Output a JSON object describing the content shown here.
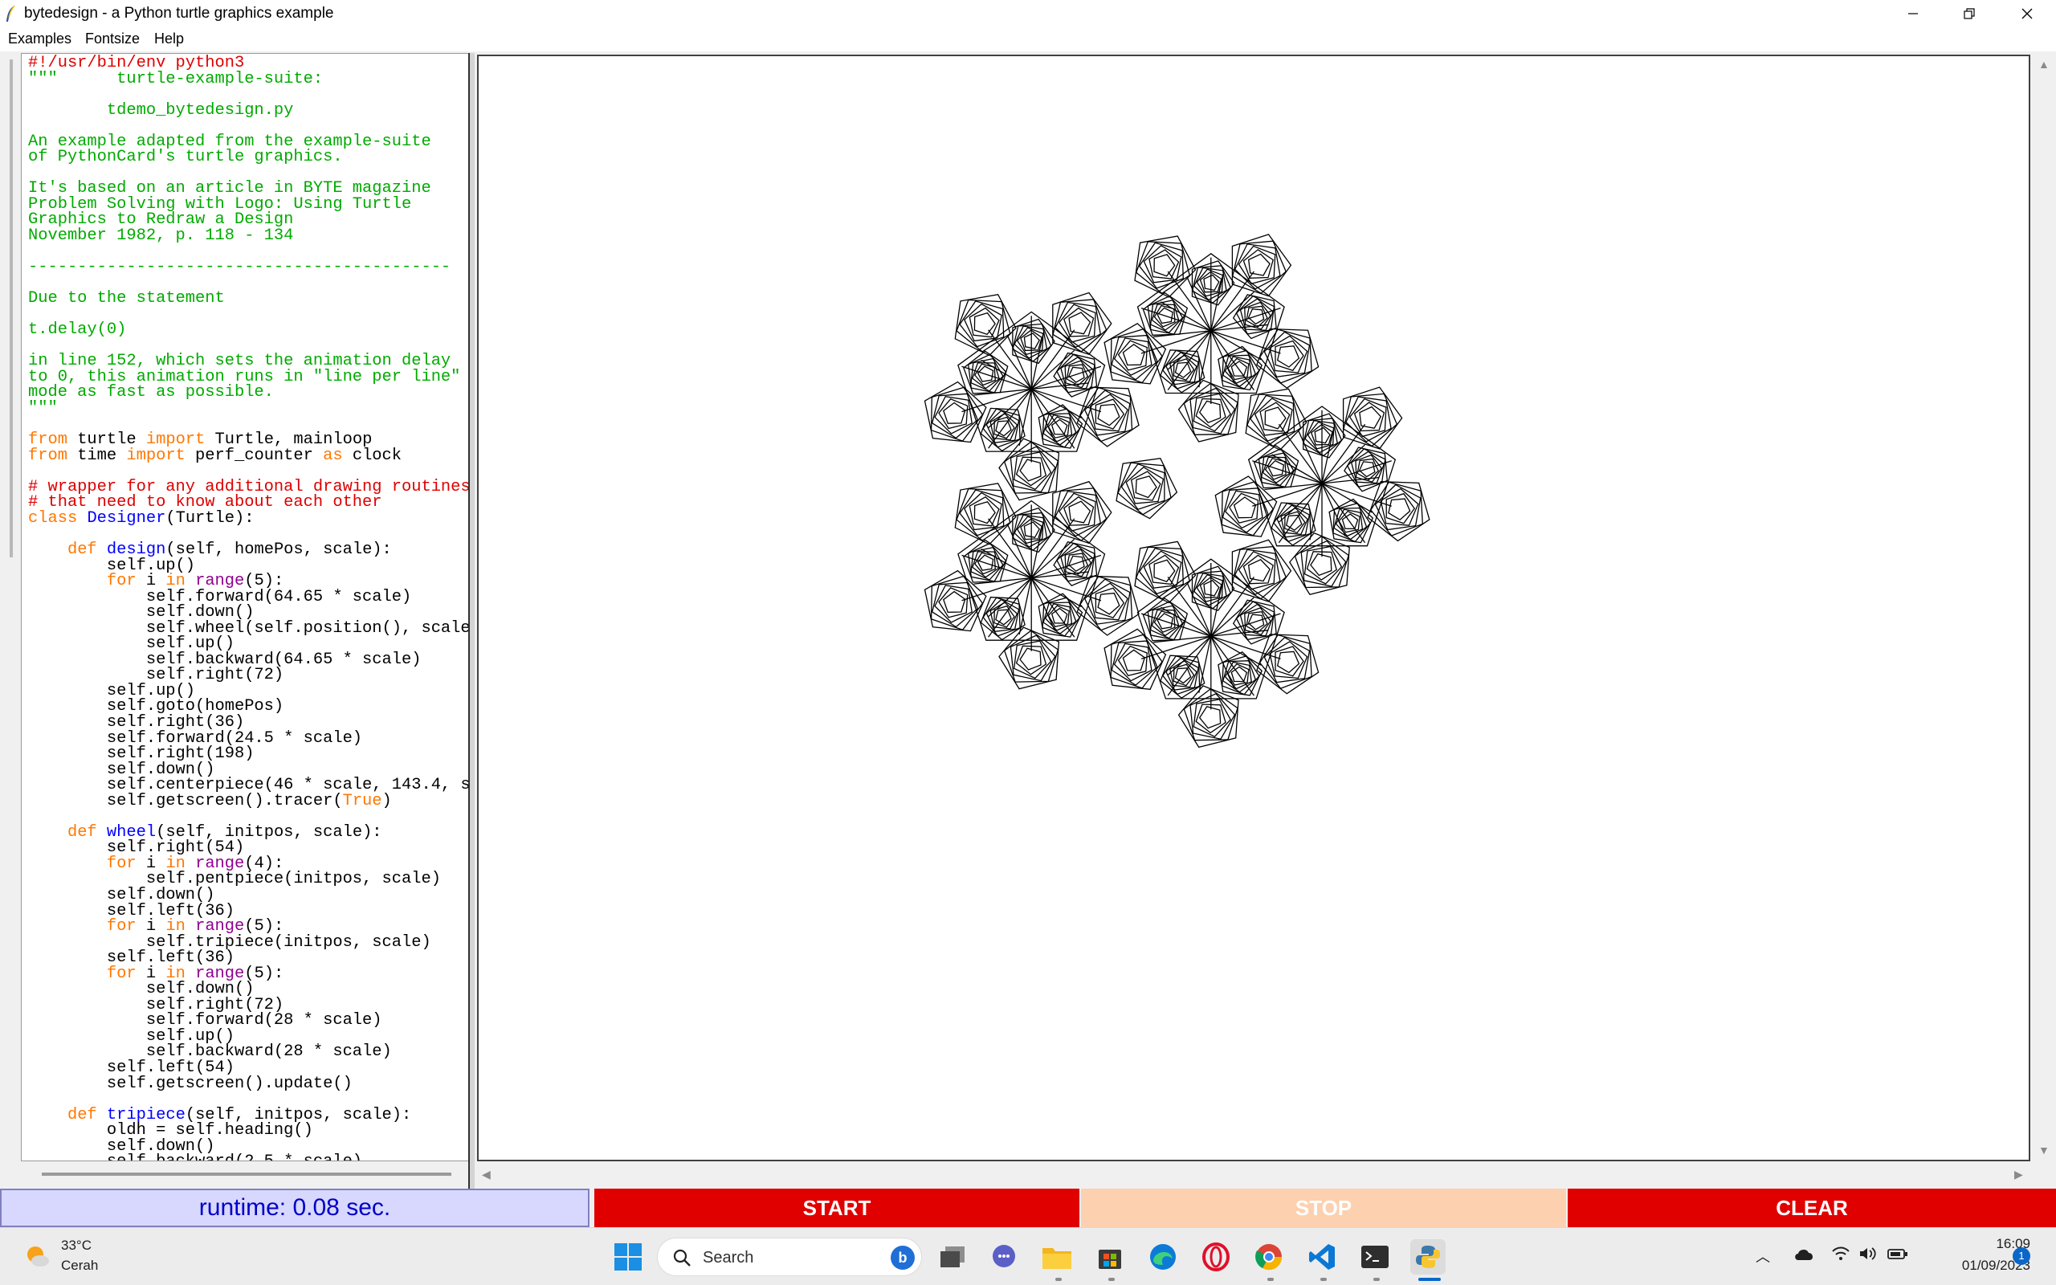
{
  "window": {
    "title": "bytedesign - a Python turtle graphics example"
  },
  "menu": [
    "Examples",
    "Fontsize",
    "Help"
  ],
  "code_lines": [
    [
      [
        "c-cmt",
        "#!/usr/bin/env python3"
      ]
    ],
    [
      [
        "c-str",
        "\"\"\"      turtle-example-suite:"
      ]
    ],
    [
      [
        "",
        ""
      ]
    ],
    [
      [
        "c-str",
        "        tdemo_bytedesign.py"
      ]
    ],
    [
      [
        "",
        ""
      ]
    ],
    [
      [
        "c-str",
        "An example adapted from the example-suite"
      ]
    ],
    [
      [
        "c-str",
        "of PythonCard's turtle graphics."
      ]
    ],
    [
      [
        "",
        ""
      ]
    ],
    [
      [
        "c-str",
        "It's based on an article in BYTE magazine"
      ]
    ],
    [
      [
        "c-str",
        "Problem Solving with Logo: Using Turtle"
      ]
    ],
    [
      [
        "c-str",
        "Graphics to Redraw a Design"
      ]
    ],
    [
      [
        "c-str",
        "November 1982, p. 118 - 134"
      ]
    ],
    [
      [
        "",
        ""
      ]
    ],
    [
      [
        "c-str",
        "-------------------------------------------"
      ]
    ],
    [
      [
        "",
        ""
      ]
    ],
    [
      [
        "c-str",
        "Due to the statement"
      ]
    ],
    [
      [
        "",
        ""
      ]
    ],
    [
      [
        "c-str",
        "t.delay(0)"
      ]
    ],
    [
      [
        "",
        ""
      ]
    ],
    [
      [
        "c-str",
        "in line 152, which sets the animation delay"
      ]
    ],
    [
      [
        "c-str",
        "to 0, this animation runs in \"line per line\""
      ]
    ],
    [
      [
        "c-str",
        "mode as fast as possible."
      ]
    ],
    [
      [
        "c-str",
        "\"\"\""
      ]
    ],
    [
      [
        "",
        ""
      ]
    ],
    [
      [
        "c-kw",
        "from"
      ],
      [
        "",
        " turtle "
      ],
      [
        "c-kw",
        "import"
      ],
      [
        "",
        " Turtle, mainloop"
      ]
    ],
    [
      [
        "c-kw",
        "from"
      ],
      [
        "",
        " time "
      ],
      [
        "c-kw",
        "import"
      ],
      [
        "",
        " perf_counter "
      ],
      [
        "c-kw",
        "as"
      ],
      [
        "",
        " clock"
      ]
    ],
    [
      [
        "",
        ""
      ]
    ],
    [
      [
        "c-cmt",
        "# wrapper for any additional drawing routines"
      ]
    ],
    [
      [
        "c-cmt",
        "# that need to know about each other"
      ]
    ],
    [
      [
        "c-kw",
        "class"
      ],
      [
        "",
        " "
      ],
      [
        "c-def",
        "Designer"
      ],
      [
        "",
        "(Turtle):"
      ]
    ],
    [
      [
        "",
        ""
      ]
    ],
    [
      [
        "",
        "    "
      ],
      [
        "c-kw",
        "def"
      ],
      [
        "",
        " "
      ],
      [
        "c-def",
        "design"
      ],
      [
        "",
        "(self, homePos, scale):"
      ]
    ],
    [
      [
        "",
        "        self.up()"
      ]
    ],
    [
      [
        "",
        "        "
      ],
      [
        "c-kw",
        "for"
      ],
      [
        "",
        " i "
      ],
      [
        "c-kw",
        "in"
      ],
      [
        "",
        " "
      ],
      [
        "c-blt",
        "range"
      ],
      [
        "",
        "(5):"
      ]
    ],
    [
      [
        "",
        "            self.forward(64.65 * scale)"
      ]
    ],
    [
      [
        "",
        "            self.down()"
      ]
    ],
    [
      [
        "",
        "            self.wheel(self.position(), scale"
      ]
    ],
    [
      [
        "",
        "            self.up()"
      ]
    ],
    [
      [
        "",
        "            self.backward(64.65 * scale)"
      ]
    ],
    [
      [
        "",
        "            self.right(72)"
      ]
    ],
    [
      [
        "",
        "        self.up()"
      ]
    ],
    [
      [
        "",
        "        self.goto(homePos)"
      ]
    ],
    [
      [
        "",
        "        self.right(36)"
      ]
    ],
    [
      [
        "",
        "        self.forward(24.5 * scale)"
      ]
    ],
    [
      [
        "",
        "        self.right(198)"
      ]
    ],
    [
      [
        "",
        "        self.down()"
      ]
    ],
    [
      [
        "",
        "        self.centerpiece(46 * scale, 143.4, s"
      ]
    ],
    [
      [
        "",
        "        self.getscreen().tracer("
      ],
      [
        "c-tf",
        "True"
      ],
      [
        "",
        ")"
      ]
    ],
    [
      [
        "",
        ""
      ]
    ],
    [
      [
        "",
        "    "
      ],
      [
        "c-kw",
        "def"
      ],
      [
        "",
        " "
      ],
      [
        "c-def",
        "wheel"
      ],
      [
        "",
        "(self, initpos, scale):"
      ]
    ],
    [
      [
        "",
        "        self.right(54)"
      ]
    ],
    [
      [
        "",
        "        "
      ],
      [
        "c-kw",
        "for"
      ],
      [
        "",
        " i "
      ],
      [
        "c-kw",
        "in"
      ],
      [
        "",
        " "
      ],
      [
        "c-blt",
        "range"
      ],
      [
        "",
        "(4):"
      ]
    ],
    [
      [
        "",
        "            self.pentpiece(initpos, scale)"
      ]
    ],
    [
      [
        "",
        "        self.down()"
      ]
    ],
    [
      [
        "",
        "        self.left(36)"
      ]
    ],
    [
      [
        "",
        "        "
      ],
      [
        "c-kw",
        "for"
      ],
      [
        "",
        " i "
      ],
      [
        "c-kw",
        "in"
      ],
      [
        "",
        " "
      ],
      [
        "c-blt",
        "range"
      ],
      [
        "",
        "(5):"
      ]
    ],
    [
      [
        "",
        "            self.tripiece(initpos, scale)"
      ]
    ],
    [
      [
        "",
        "        self.left(36)"
      ]
    ],
    [
      [
        "",
        "        "
      ],
      [
        "c-kw",
        "for"
      ],
      [
        "",
        " i "
      ],
      [
        "c-kw",
        "in"
      ],
      [
        "",
        " "
      ],
      [
        "c-blt",
        "range"
      ],
      [
        "",
        "(5):"
      ]
    ],
    [
      [
        "",
        "            self.down()"
      ]
    ],
    [
      [
        "",
        "            self.right(72)"
      ]
    ],
    [
      [
        "",
        "            self.forward(28 * scale)"
      ]
    ],
    [
      [
        "",
        "            self.up()"
      ]
    ],
    [
      [
        "",
        "            self.backward(28 * scale)"
      ]
    ],
    [
      [
        "",
        "        self.left(54)"
      ]
    ],
    [
      [
        "",
        "        self.getscreen().update()"
      ]
    ],
    [
      [
        "",
        ""
      ]
    ],
    [
      [
        "",
        "    "
      ],
      [
        "c-kw",
        "def"
      ],
      [
        "",
        " "
      ],
      [
        "c-def",
        "tripiece"
      ],
      [
        "",
        "(self, initpos, scale):"
      ]
    ],
    [
      [
        "",
        "        oldh = self.heading()"
      ]
    ],
    [
      [
        "",
        "        self.down()"
      ]
    ],
    [
      [
        "",
        "        self.backward(2.5 * scale)"
      ]
    ]
  ],
  "controls": {
    "runtime": "runtime: 0.08 sec.",
    "start": "START",
    "stop": "STOP",
    "clear": "CLEAR"
  },
  "taskbar": {
    "temperature": "33°C",
    "weather": "Cerah",
    "search_placeholder": "Search",
    "time": "16:09",
    "date": "01/09/2023",
    "notifications": "1",
    "apps": [
      "start-menu",
      "search",
      "task-view",
      "teams-chat",
      "file-explorer",
      "microsoft-store",
      "edge",
      "opera",
      "chrome",
      "vs-code",
      "terminal",
      "python-turtle"
    ]
  },
  "colors": {
    "start_button": "#e00000",
    "stop_button_disabled": "#fdd0b0",
    "clear_button": "#e00000",
    "runtime_bg": "#d8d8ff",
    "runtime_text": "#0000c8"
  }
}
